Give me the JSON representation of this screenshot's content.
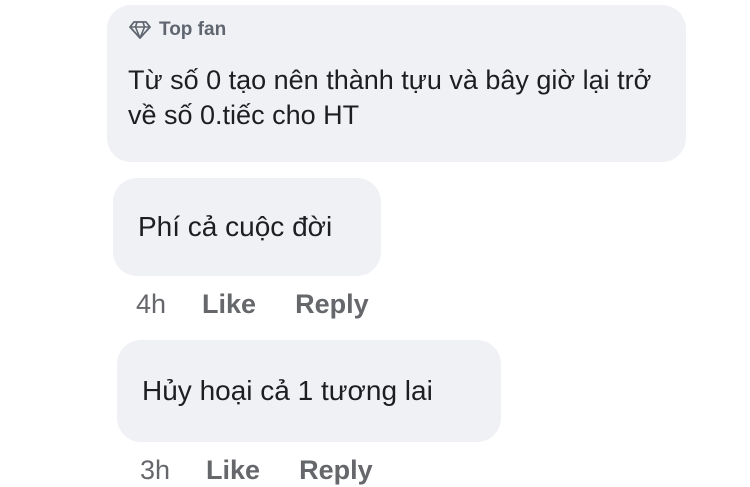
{
  "comments": [
    {
      "badge": "Top fan",
      "badge_icon": "diamond-icon",
      "text": "Từ số 0 tạo nên thành tựu và bây giờ lại trở về số 0.tiếc cho HT"
    },
    {
      "text": "Phí cả cuộc đời",
      "time": "4h",
      "like": "Like",
      "reply": "Reply"
    },
    {
      "text": "Hủy hoại cả 1 tương lai",
      "time": "3h",
      "like": "Like",
      "reply": "Reply"
    }
  ],
  "colors": {
    "bubble": "#f0f1f5",
    "text": "#1c1e21",
    "muted": "#65676b"
  }
}
